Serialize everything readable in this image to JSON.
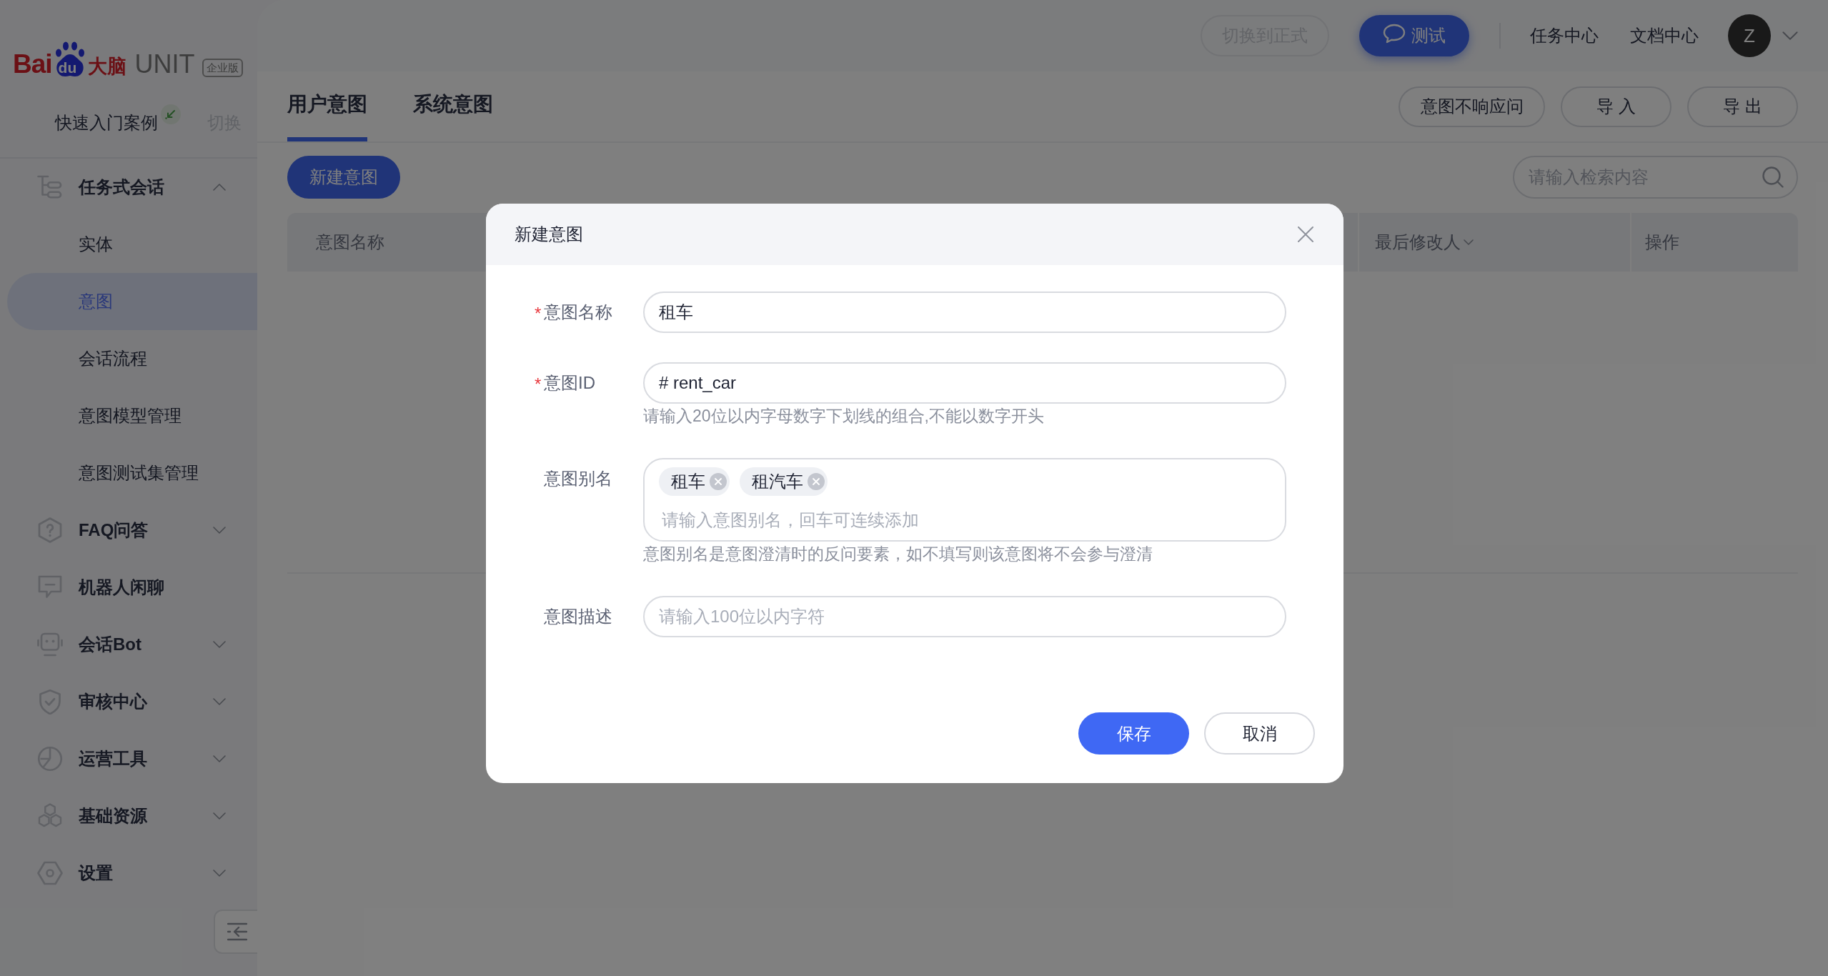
{
  "logo": {
    "text": "Bai",
    "mark_text": "du",
    "name": "大脑",
    "product": "UNIT",
    "edition": "企业版"
  },
  "project": {
    "name": "快速入门案例",
    "switch_link": "切换"
  },
  "sidebar": {
    "items": [
      {
        "label": "任务式会话",
        "kind": "group",
        "expanded": true,
        "selected": false,
        "children": [
          {
            "label": "实体",
            "selected": false
          },
          {
            "label": "意图",
            "selected": true
          },
          {
            "label": "会话流程",
            "selected": false
          },
          {
            "label": "意图模型管理",
            "selected": false
          },
          {
            "label": "意图测试集管理",
            "selected": false
          }
        ]
      },
      {
        "label": "FAQ问答",
        "kind": "group",
        "expanded": false,
        "selected": false
      },
      {
        "label": "机器人闲聊",
        "kind": "link",
        "selected": false
      },
      {
        "label": "会话Bot",
        "kind": "group",
        "expanded": false,
        "selected": false
      },
      {
        "label": "审核中心",
        "kind": "group",
        "expanded": false,
        "selected": false
      },
      {
        "label": "运营工具",
        "kind": "group",
        "expanded": false,
        "selected": false
      },
      {
        "label": "基础资源",
        "kind": "group",
        "expanded": false,
        "selected": false
      },
      {
        "label": "设置",
        "kind": "group",
        "expanded": false,
        "selected": false
      }
    ]
  },
  "top_bar": {
    "buttons": [
      {
        "label": "切换到正式",
        "kind": "outline",
        "disabled": true
      },
      {
        "label": "测试",
        "kind": "primary",
        "disabled": false
      }
    ],
    "links": [
      "任务中心",
      "文档中心"
    ],
    "user": {
      "initial": "Z"
    }
  },
  "tabs": [
    {
      "label": "用户意图",
      "selected": true
    },
    {
      "label": "系统意图",
      "selected": false
    }
  ],
  "tab_actions": [
    "意图不响应问",
    "导 入",
    "导 出"
  ],
  "toolbar": {
    "new_button": "新建意图",
    "search": {
      "placeholder": "请输入检索内容"
    }
  },
  "table": {
    "columns": [
      {
        "label": "意图名称",
        "dropdown": false
      },
      {
        "label": "最后修改人",
        "dropdown": true
      },
      {
        "label": "操作",
        "dropdown": false
      }
    ]
  },
  "dialog": {
    "title": "新建意图",
    "fields": [
      {
        "kind": "text",
        "required_mark": "*",
        "label": "意图名称",
        "value": "租车"
      },
      {
        "kind": "text",
        "required_mark": "*",
        "label": "意图ID",
        "value": "# rent_car",
        "hint": "请输入20位以内字母数字下划线的组合,不能以数字开头"
      },
      {
        "kind": "tags",
        "label": "意图别名",
        "tags": [
          "租车",
          "租汽车"
        ],
        "placeholder": "请输入意图别名，回车可连续添加",
        "hint": "意图别名是意图澄清时的反问要素，如不填写则该意图将不会参与澄清"
      },
      {
        "kind": "text",
        "label": "意图描述",
        "placeholder": "请输入100位以内字符"
      }
    ],
    "buttons": [
      {
        "label": "保存",
        "kind": "primary"
      },
      {
        "label": "取消",
        "kind": "outline"
      }
    ]
  }
}
